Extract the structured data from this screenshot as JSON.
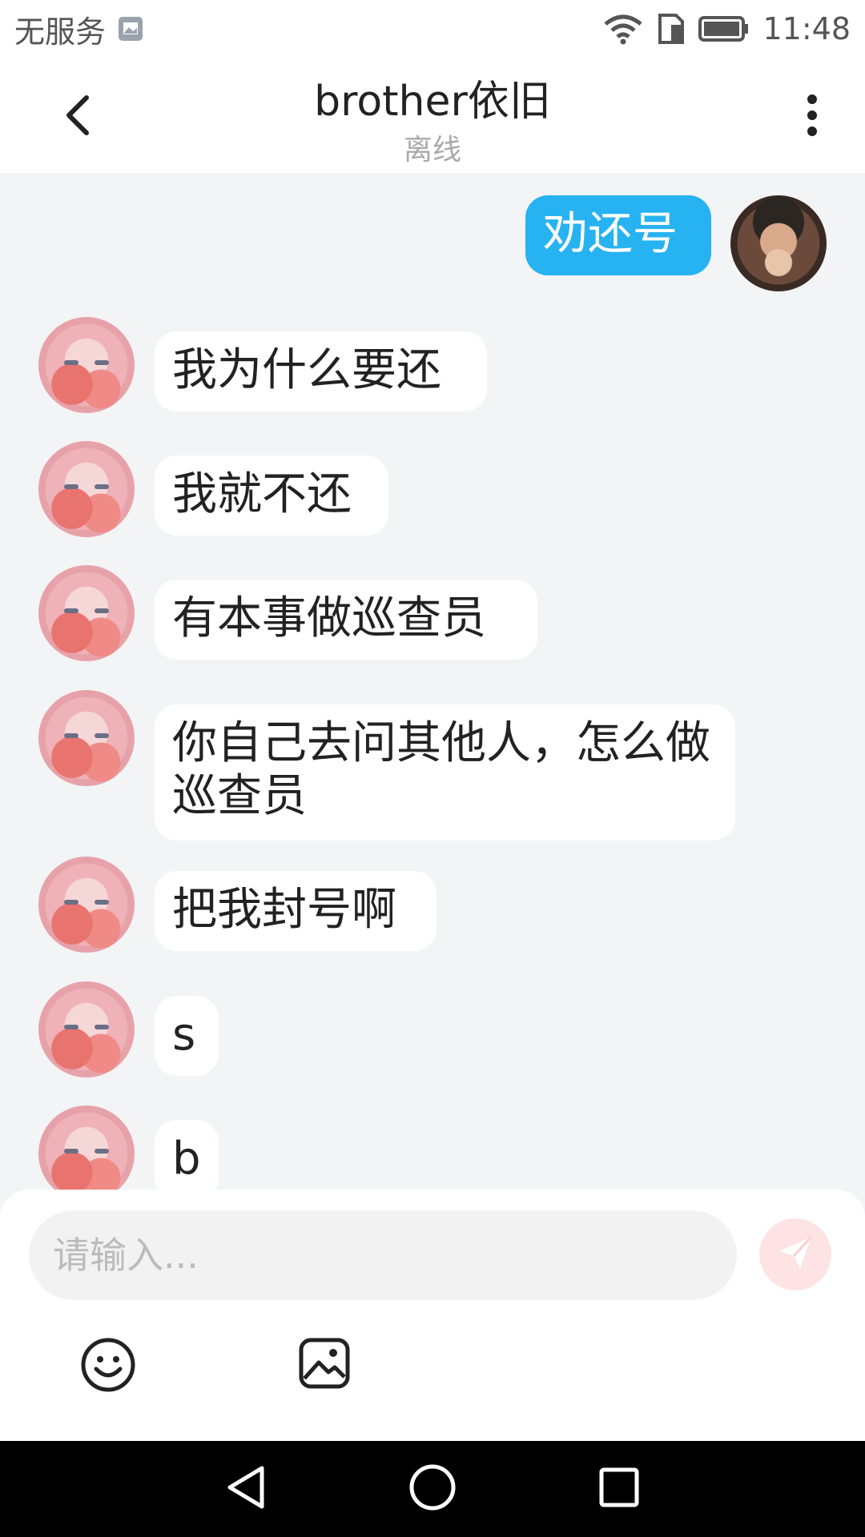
{
  "status_bar": {
    "carrier": "无服务",
    "time": "11:48",
    "icons": [
      "image-notification-icon",
      "wifi-icon",
      "sim-icon",
      "battery-icon"
    ]
  },
  "header": {
    "title": "brother依旧",
    "subtitle": "离线"
  },
  "messages": [
    {
      "sender": "me",
      "text": "劝还号"
    },
    {
      "sender": "other",
      "text": "我为什么要还"
    },
    {
      "sender": "other",
      "text": "我就不还"
    },
    {
      "sender": "other",
      "text": "有本事做巡查员"
    },
    {
      "sender": "other",
      "text": "你自己去问其他人，怎么做巡查员"
    },
    {
      "sender": "other",
      "text": "把我封号啊"
    },
    {
      "sender": "other",
      "text": "s"
    },
    {
      "sender": "other",
      "text": "b"
    }
  ],
  "input": {
    "placeholder": "请输入..."
  },
  "toolbar": {
    "icons": [
      "emoji-icon",
      "image-icon"
    ]
  },
  "colors": {
    "my_bubble": "#27b2f1",
    "background": "#f3f4f6",
    "send_button": "#fde3e3"
  }
}
